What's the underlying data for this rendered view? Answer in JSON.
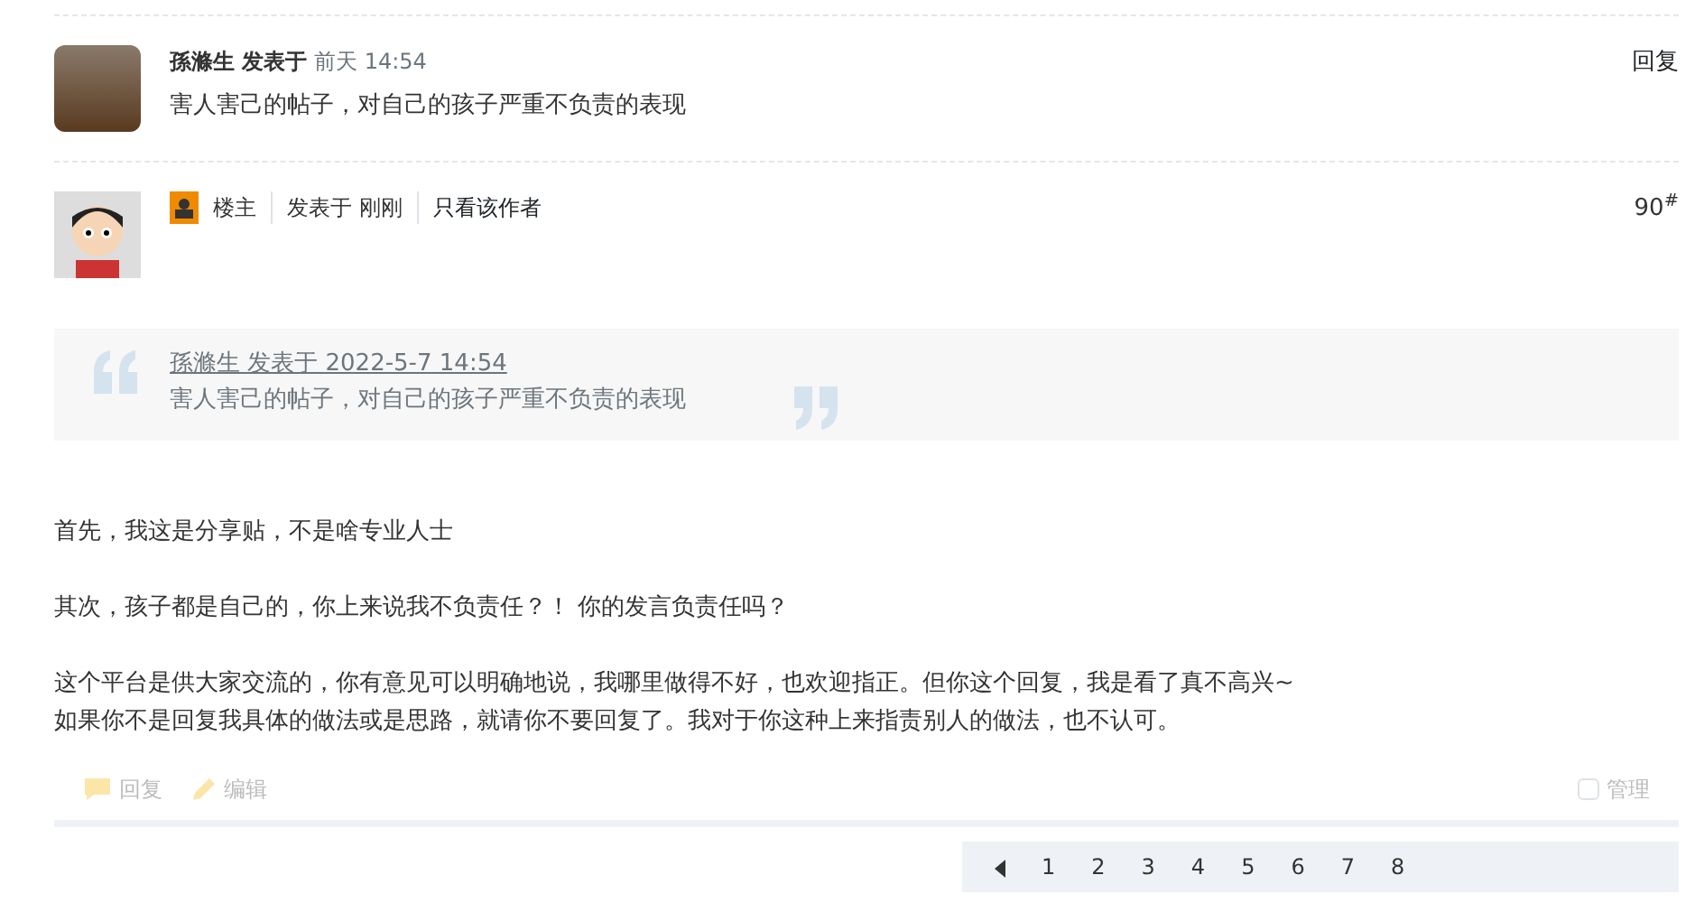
{
  "reply": {
    "author": "孫滌生",
    "posted_label": "发表于",
    "time": "前天 14:54",
    "text": "害人害己的帖子，对自己的孩子严重不负责的表现",
    "reply_link": "回复"
  },
  "post": {
    "role": "楼主",
    "posted": "发表于 刚刚",
    "only_author": "只看该作者",
    "floor": "90",
    "floor_mark": "#",
    "quote": {
      "header": "孫滌生 发表于 2022-5-7 14:54",
      "text": "害人害己的帖子，对自己的孩子严重不负责的表现"
    },
    "paragraphs": [
      [
        "首先，我这是分享贴，不是啥专业人士"
      ],
      [
        "其次，孩子都是自己的，你上来说我不负责任？！  你的发言负责任吗？"
      ],
      [
        "这个平台是供大家交流的，你有意见可以明确地说，我哪里做得不好，也欢迎指正。但你这个回复，我是看了真不高兴~",
        "如果你不是回复我具体的做法或是思路，就请你不要回复了。我对于你这种上来指责别人的做法，也不认可。"
      ]
    ],
    "actions": [
      {
        "kind": "reply",
        "label": "回复"
      },
      {
        "kind": "edit",
        "label": "编辑"
      }
    ],
    "manage": {
      "label": "管理",
      "checked": false
    }
  },
  "pagination": {
    "pages": [
      {
        "label": "1",
        "selected": false
      },
      {
        "label": "2",
        "selected": false
      },
      {
        "label": "3",
        "selected": false
      },
      {
        "label": "4",
        "selected": false
      },
      {
        "label": "5",
        "selected": false
      },
      {
        "label": "6",
        "selected": false
      },
      {
        "label": "7",
        "selected": false
      },
      {
        "label": "8",
        "selected": false
      }
    ]
  }
}
